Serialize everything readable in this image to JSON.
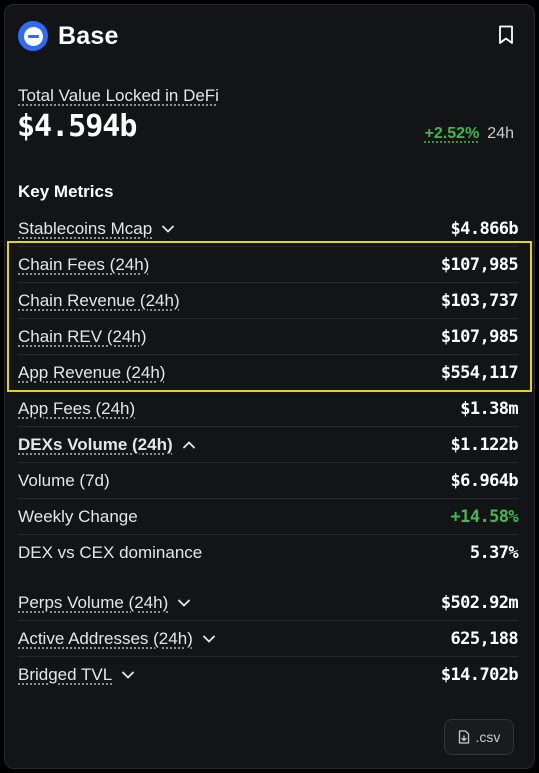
{
  "chain": {
    "name": "Base"
  },
  "tvl": {
    "label": "Total Value Locked in DeFi",
    "value": "$4.594b",
    "change": "+2.52%",
    "period": "24h"
  },
  "metrics": {
    "title": "Key Metrics",
    "rows": [
      {
        "label": "Stablecoins Mcap",
        "value": "$4.866b"
      },
      {
        "label": "Chain Fees (24h)",
        "value": "$107,985"
      },
      {
        "label": "Chain Revenue (24h)",
        "value": "$103,737"
      },
      {
        "label": "Chain REV (24h)",
        "value": "$107,985"
      },
      {
        "label": "App Revenue (24h)",
        "value": "$554,117"
      },
      {
        "label": "App Fees (24h)",
        "value": "$1.38m"
      },
      {
        "label": "DEXs Volume (24h)",
        "value": "$1.122b"
      },
      {
        "label": "Volume (7d)",
        "value": "$6.964b"
      },
      {
        "label": "Weekly Change",
        "value": "+14.58%"
      },
      {
        "label": "DEX vs CEX dominance",
        "value": "5.37%"
      },
      {
        "label": "Perps Volume (24h)",
        "value": "$502.92m"
      },
      {
        "label": "Active Addresses (24h)",
        "value": "625,188"
      },
      {
        "label": "Bridged TVL",
        "value": "$14.702b"
      }
    ]
  },
  "csv": {
    "label": ".csv"
  },
  "colors": {
    "accent": "#2f6cf6",
    "positive": "#3fb950",
    "highlight": "#e6d11c",
    "card": "#131415"
  }
}
